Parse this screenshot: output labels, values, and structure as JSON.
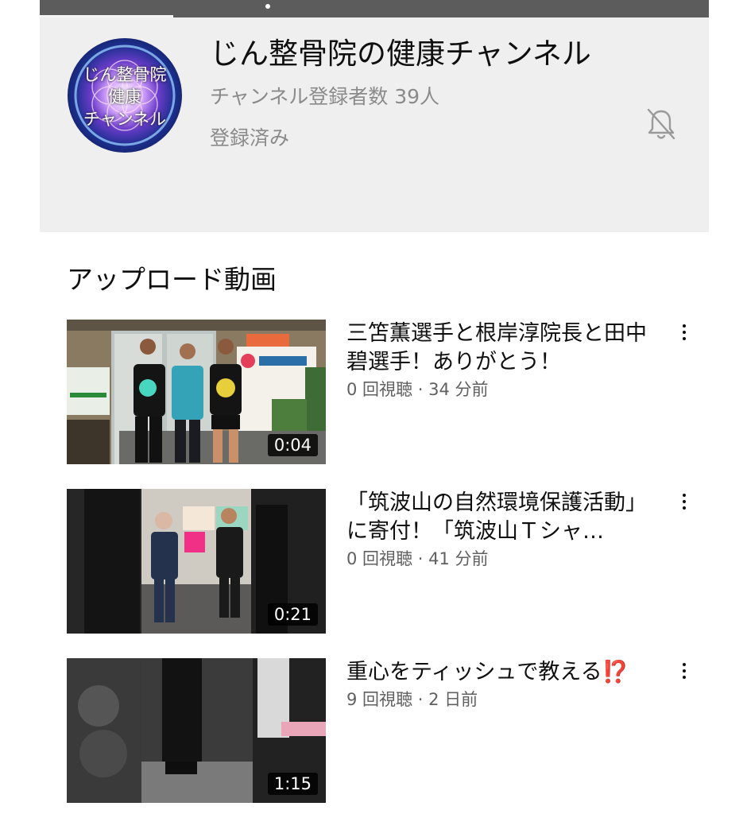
{
  "channel": {
    "name": "じん整骨院の健康チャンネル",
    "subscribers": "チャンネル登録者数 39人",
    "subscribe_state": "登録済み",
    "avatar_text": [
      "じん整骨院",
      "健康",
      "チャンネル"
    ]
  },
  "section": {
    "title": "アップロード動画"
  },
  "videos": [
    {
      "title": "三笘薫選手と根岸淳院長と田中碧選手！ありがとう！",
      "views": "0 回視聴",
      "ago": "34 分前",
      "duration": "0:04"
    },
    {
      "title": "「筑波山の自然環境保護活動」に寄付！「筑波山Ｔシャ…",
      "views": "0 回視聴",
      "ago": "41 分前",
      "duration": "0:21"
    },
    {
      "title": "重心をティッシュで教える⁉️",
      "views": "9 回視聴",
      "ago": "2 日前",
      "duration": "1:15"
    }
  ],
  "icons": {
    "bell": "bell-off-icon",
    "menu": "more-vert-icon"
  },
  "colors": {
    "header_bg": "#efefef",
    "topbar": "#5c5c5c",
    "meta_text": "#606060"
  }
}
